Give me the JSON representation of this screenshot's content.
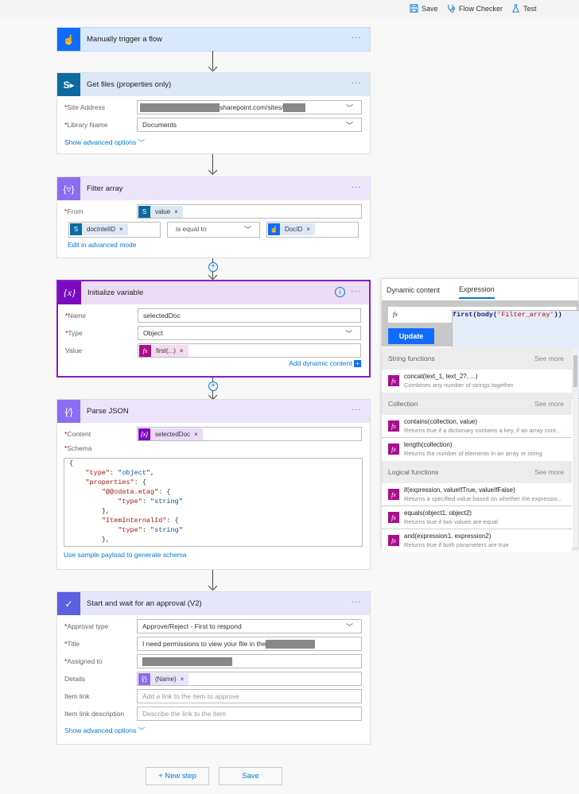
{
  "toolbar": {
    "save": "Save",
    "flow_checker": "Flow Checker",
    "test": "Test"
  },
  "steps": {
    "trigger": {
      "title": "Manually trigger a flow",
      "color": "#0f6cff",
      "head_bg": "#d9e8fb"
    },
    "get_files": {
      "title": "Get files (properties only)",
      "site_label": "Site Address",
      "site_value": "sharepoint.com/sites/",
      "library_label": "Library Name",
      "library_value": "Documents",
      "advanced": "Show advanced options"
    },
    "filter": {
      "title": "Filter array",
      "from_label": "From",
      "from_token": "value",
      "left_token": "docIntelID",
      "operator": "is equal to",
      "right_token": "DocID",
      "advanced_mode": "Edit in advanced mode"
    },
    "init_var": {
      "title": "Initialize variable",
      "name_label": "Name",
      "name_value": "selectedDoc",
      "type_label": "Type",
      "type_value": "Object",
      "value_label": "Value",
      "value_token": "first(...)",
      "add_dynamic": "Add dynamic content"
    },
    "parse_json": {
      "title": "Parse JSON",
      "content_label": "Content",
      "content_token": "selectedDoc",
      "schema_label": "Schema",
      "schema_lines": [
        "{",
        "    \"type\": \"object\",",
        "    \"properties\": {",
        "        \"@@odata.etag\": {",
        "            \"type\": \"string\"",
        "        },",
        "        \"ItemInternalId\": {",
        "            \"type\": \"string\"",
        "        },"
      ],
      "sample_link": "Use sample payload to generate schema"
    },
    "approval": {
      "title": "Start and wait for an approval (V2)",
      "type_label": "Approval type",
      "type_value": "Approve/Reject - First to respond",
      "title_label": "Title",
      "title_value": "I need permissions to view your file in the",
      "assigned_label": "Assigned to",
      "details_label": "Details",
      "details_token": "(Name)",
      "item_link_label": "Item link",
      "item_link_placeholder": "Add a link to the item to approve",
      "item_desc_label": "Item link description",
      "item_desc_placeholder": "Describe the link to the item",
      "advanced": "Show advanced options"
    }
  },
  "panel": {
    "tabs": [
      "Dynamic content",
      "Expression"
    ],
    "active_tab": "Expression",
    "expression_fn": "first(body(",
    "expression_arg": "'Filter_array'",
    "expression_end": "))",
    "update": "Update",
    "sections": [
      {
        "name": "String functions",
        "see_more": "See more",
        "items": [
          {
            "name": "concat(text_1, text_2?, ...)",
            "desc": "Combines any number of strings together"
          }
        ]
      },
      {
        "name": "Collection",
        "see_more": "See more",
        "items": [
          {
            "name": "contains(collection, value)",
            "desc": "Returns true if a dictionary contains a key, if an array cont..."
          },
          {
            "name": "length(collection)",
            "desc": "Returns the number of elements in an array or string"
          }
        ]
      },
      {
        "name": "Logical functions",
        "see_more": "See more",
        "items": [
          {
            "name": "if(expression, valueIfTrue, valueIfFalse)",
            "desc": "Returns a specified value based on whether the expressio..."
          },
          {
            "name": "equals(object1, object2)",
            "desc": "Returns true if two values are equal"
          },
          {
            "name": "and(expression1, expression2)",
            "desc": "Returns true if both parameters are true"
          }
        ]
      }
    ]
  },
  "footer": {
    "new_step": "+ New step",
    "save": "Save"
  }
}
